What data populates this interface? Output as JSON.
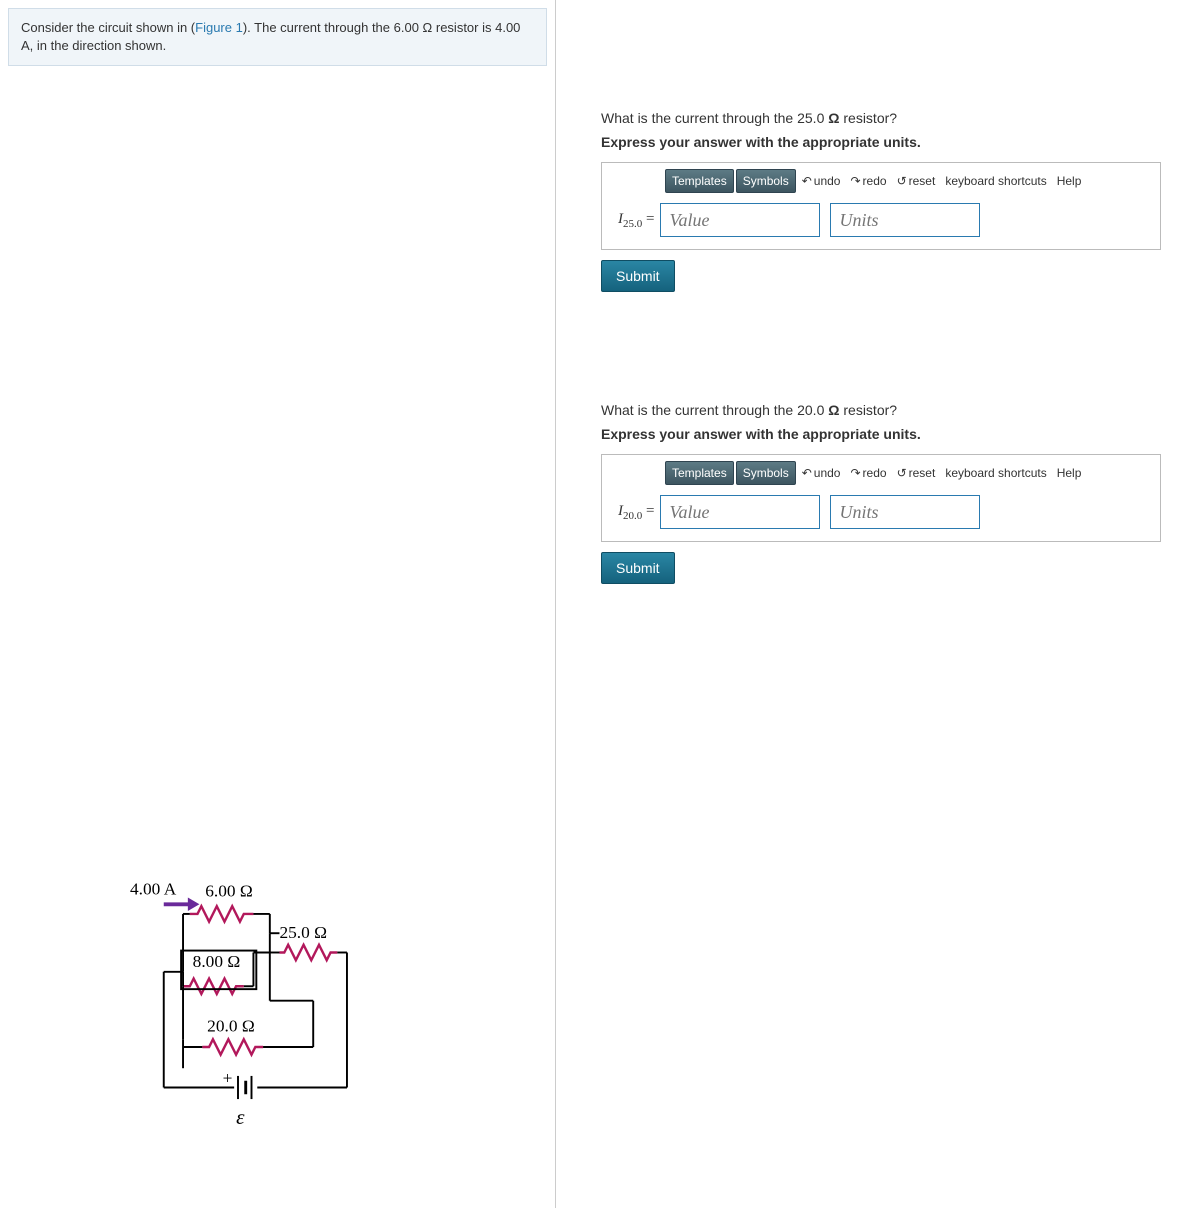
{
  "problem": {
    "text_before": "Consider the circuit shown in (",
    "figure_link": "Figure 1",
    "text_after": "). The current through the 6.00 Ω resistor is 4.00 A, in the direction shown."
  },
  "questions": [
    {
      "prompt_before": "What is the current through the 25.0 ",
      "unit_sym": "Ω",
      "prompt_after": " resistor?",
      "instruction": "Express your answer with the appropriate units.",
      "var_prefix": "I",
      "var_sub": "25.0",
      "eq_sign": "=",
      "value_placeholder": "Value",
      "units_placeholder": "Units",
      "submit": "Submit"
    },
    {
      "prompt_before": "What is the current through the 20.0 ",
      "unit_sym": "Ω",
      "prompt_after": " resistor?",
      "instruction": "Express your answer with the appropriate units.",
      "var_prefix": "I",
      "var_sub": "20.0",
      "eq_sign": "=",
      "value_placeholder": "Value",
      "units_placeholder": "Units",
      "submit": "Submit"
    }
  ],
  "toolbar": {
    "templates": "Templates",
    "symbols": "Symbols",
    "undo": "undo",
    "redo": "redo",
    "reset": "reset",
    "keyboard": "keyboard shortcuts",
    "help": "Help"
  },
  "circuit": {
    "current_label": "4.00 A",
    "r1": "6.00 Ω",
    "r2": "25.0 Ω",
    "r3": "8.00 Ω",
    "r4": "20.0 Ω",
    "plus": "+",
    "emf": "ε"
  }
}
